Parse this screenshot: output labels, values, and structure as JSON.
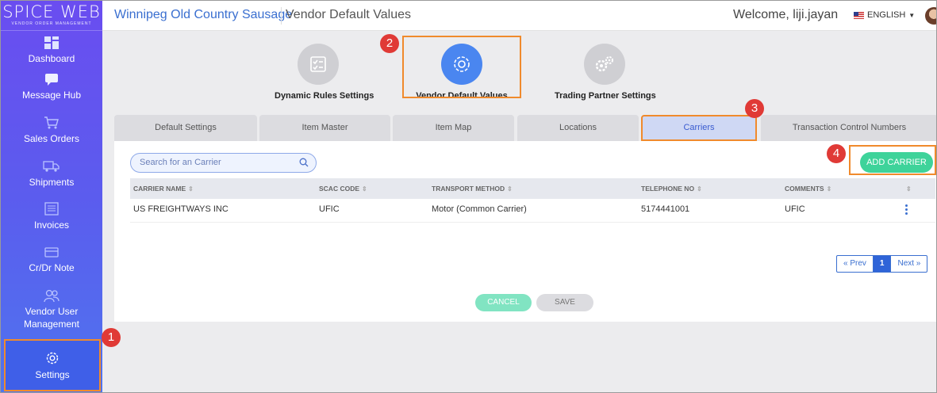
{
  "sidebar": {
    "logo": "SPICE WEB",
    "logo_sub": "VENDOR ORDER MANAGEMENT",
    "items": [
      {
        "label": "Dashboard",
        "icon": "dashboard-icon"
      },
      {
        "label": "Message Hub",
        "icon": "chat-icon"
      },
      {
        "label": "Sales Orders",
        "icon": "cart-icon"
      },
      {
        "label": "Shipments",
        "icon": "truck-icon"
      },
      {
        "label": "Invoices",
        "icon": "invoice-icon"
      },
      {
        "label": "Cr/Dr Note",
        "icon": "card-icon"
      },
      {
        "label": "Vendor User Management",
        "icon": "users-icon"
      },
      {
        "label": "Settings",
        "icon": "gear-icon"
      }
    ]
  },
  "header": {
    "company": "Winnipeg Old Country Sausage",
    "page_title": "Vendor Default Values",
    "welcome": "Welcome, liji.jayan",
    "language": "ENGLISH"
  },
  "settings_nav": [
    {
      "label": "Dynamic Rules Settings",
      "icon": "checklist-icon",
      "active": false
    },
    {
      "label": "Vendor Default Values",
      "icon": "gear-icon",
      "active": true
    },
    {
      "label": "Trading Partner Settings",
      "icon": "gears-icon",
      "active": false
    }
  ],
  "tabs": [
    "Default Settings",
    "Item Master",
    "Item Map",
    "Locations",
    "Carriers",
    "Transaction Control Numbers"
  ],
  "active_tab": "Carriers",
  "search": {
    "placeholder": "Search for an Carrier"
  },
  "add_button": "ADD CARRIER",
  "table": {
    "columns": [
      "CARRIER NAME",
      "SCAC CODE",
      "TRANSPORT METHOD",
      "TELEPHONE NO",
      "COMMENTS"
    ],
    "rows": [
      [
        "US FREIGHTWAYS INC",
        "UFIC",
        "Motor (Common Carrier)",
        "5174441001",
        "UFIC"
      ]
    ]
  },
  "pagination": {
    "prev": "« Prev",
    "current": "1",
    "next": "Next »"
  },
  "form_buttons": {
    "cancel": "CANCEL",
    "save": "SAVE"
  },
  "badges": [
    "1",
    "2",
    "3",
    "4"
  ],
  "colors": {
    "accent": "#3a6fd0",
    "highlight": "#f08a2c",
    "badge": "#e03a36",
    "add_button": "#3ed39a"
  }
}
